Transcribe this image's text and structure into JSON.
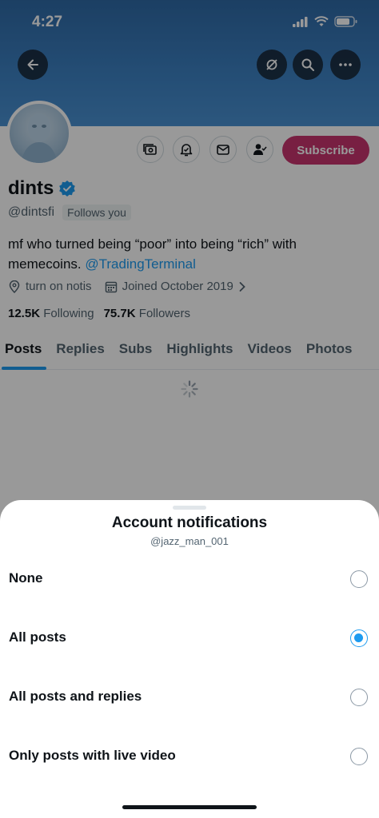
{
  "status_bar": {
    "time": "4:27"
  },
  "profile": {
    "name": "dints",
    "handle": "@dintsfi",
    "follows_you": "Follows you",
    "bio_text": "mf who turned being “poor” into being “rich” with memecoins.",
    "bio_mention": "@TradingTerminal",
    "location": "turn on notis",
    "joined": "Joined October 2019",
    "following_count": "12.5K",
    "following_label": "Following",
    "followers_count": "75.7K",
    "followers_label": "Followers",
    "subscribe_label": "Subscribe"
  },
  "tabs": [
    {
      "label": "Posts",
      "active": true
    },
    {
      "label": "Replies"
    },
    {
      "label": "Subs"
    },
    {
      "label": "Highlights"
    },
    {
      "label": "Videos"
    },
    {
      "label": "Photos"
    }
  ],
  "sheet": {
    "title": "Account notifications",
    "subtitle": "@jazz_man_001",
    "options": [
      {
        "label": "None",
        "selected": false
      },
      {
        "label": "All posts",
        "selected": true
      },
      {
        "label": "All posts and replies",
        "selected": false
      },
      {
        "label": "Only posts with live video",
        "selected": false
      }
    ]
  },
  "colors": {
    "accent": "#1d9bf0",
    "subscribe": "#c9356e",
    "banner": "#3d82c4"
  }
}
